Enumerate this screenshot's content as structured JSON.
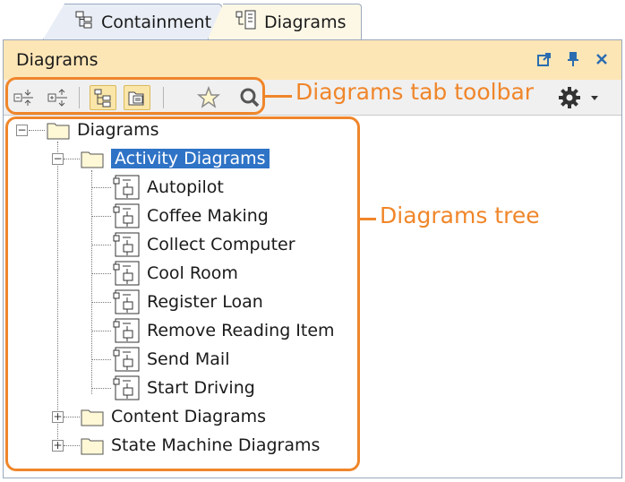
{
  "tabs": [
    {
      "label": "Containment",
      "icon": "containment-tree-icon",
      "active": false
    },
    {
      "label": "Diagrams",
      "icon": "diagrams-tab-icon",
      "active": true
    }
  ],
  "panel": {
    "title": "Diagrams",
    "title_buttons": [
      "float-window-icon",
      "pin-icon",
      "close-icon"
    ]
  },
  "toolbar": {
    "buttons": [
      "collapse-all-icon",
      "expand-all-icon",
      "show-hierarchy-icon",
      "group-by-type-icon",
      "favorite-star-icon",
      "search-icon"
    ],
    "pressed": [
      "show-hierarchy-icon",
      "group-by-type-icon"
    ],
    "options_icon": "gear-icon"
  },
  "annotations": {
    "toolbar_label": "Diagrams tab toolbar",
    "tree_label": "Diagrams tree",
    "color": "#f0862a"
  },
  "tree": {
    "root": "Diagrams",
    "groups": [
      {
        "label": "Activity Diagrams",
        "expanded": true,
        "selected": true,
        "children": [
          "Autopilot",
          "Coffee Making",
          "Collect Computer",
          "Cool Room",
          "Register Loan",
          "Remove Reading Item",
          "Send Mail",
          "Start Driving"
        ]
      },
      {
        "label": "Content Diagrams",
        "expanded": false
      },
      {
        "label": "State Machine Diagrams",
        "expanded": false
      }
    ]
  }
}
